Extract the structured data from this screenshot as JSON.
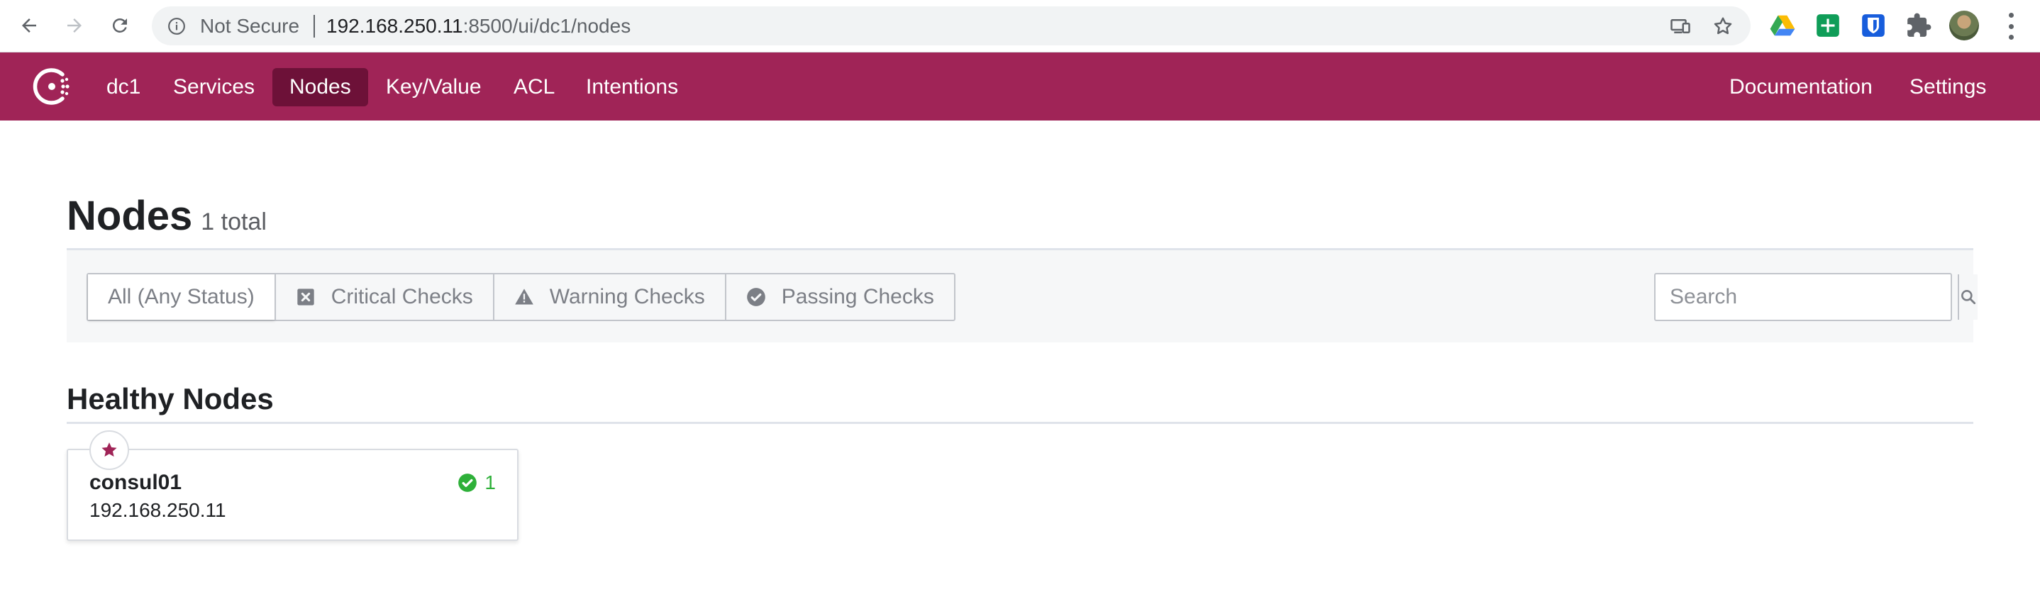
{
  "browser": {
    "security_label": "Not Secure",
    "url_host": "192.168.250.11",
    "url_rest": ":8500/ui/dc1/nodes"
  },
  "topnav": {
    "datacenter": "dc1",
    "items": [
      "Services",
      "Nodes",
      "Key/Value",
      "ACL",
      "Intentions"
    ],
    "active": "Nodes",
    "right_items": [
      "Documentation",
      "Settings"
    ],
    "brand_color": "#a02457",
    "active_color": "#6d1138"
  },
  "page": {
    "title": "Nodes",
    "count": "1 total"
  },
  "filters": {
    "tabs": [
      {
        "label": "All (Any Status)",
        "icon": "none",
        "selected": true
      },
      {
        "label": "Critical Checks",
        "icon": "critical-x-icon"
      },
      {
        "label": "Warning Checks",
        "icon": "warning-triangle-icon"
      },
      {
        "label": "Passing Checks",
        "icon": "passing-check-icon"
      }
    ],
    "search_placeholder": "Search"
  },
  "section": {
    "title": "Healthy Nodes"
  },
  "nodes": [
    {
      "name": "consul01",
      "address": "192.168.250.11",
      "passing_checks": "1",
      "leader": true,
      "status_color": "#2eb039"
    }
  ]
}
